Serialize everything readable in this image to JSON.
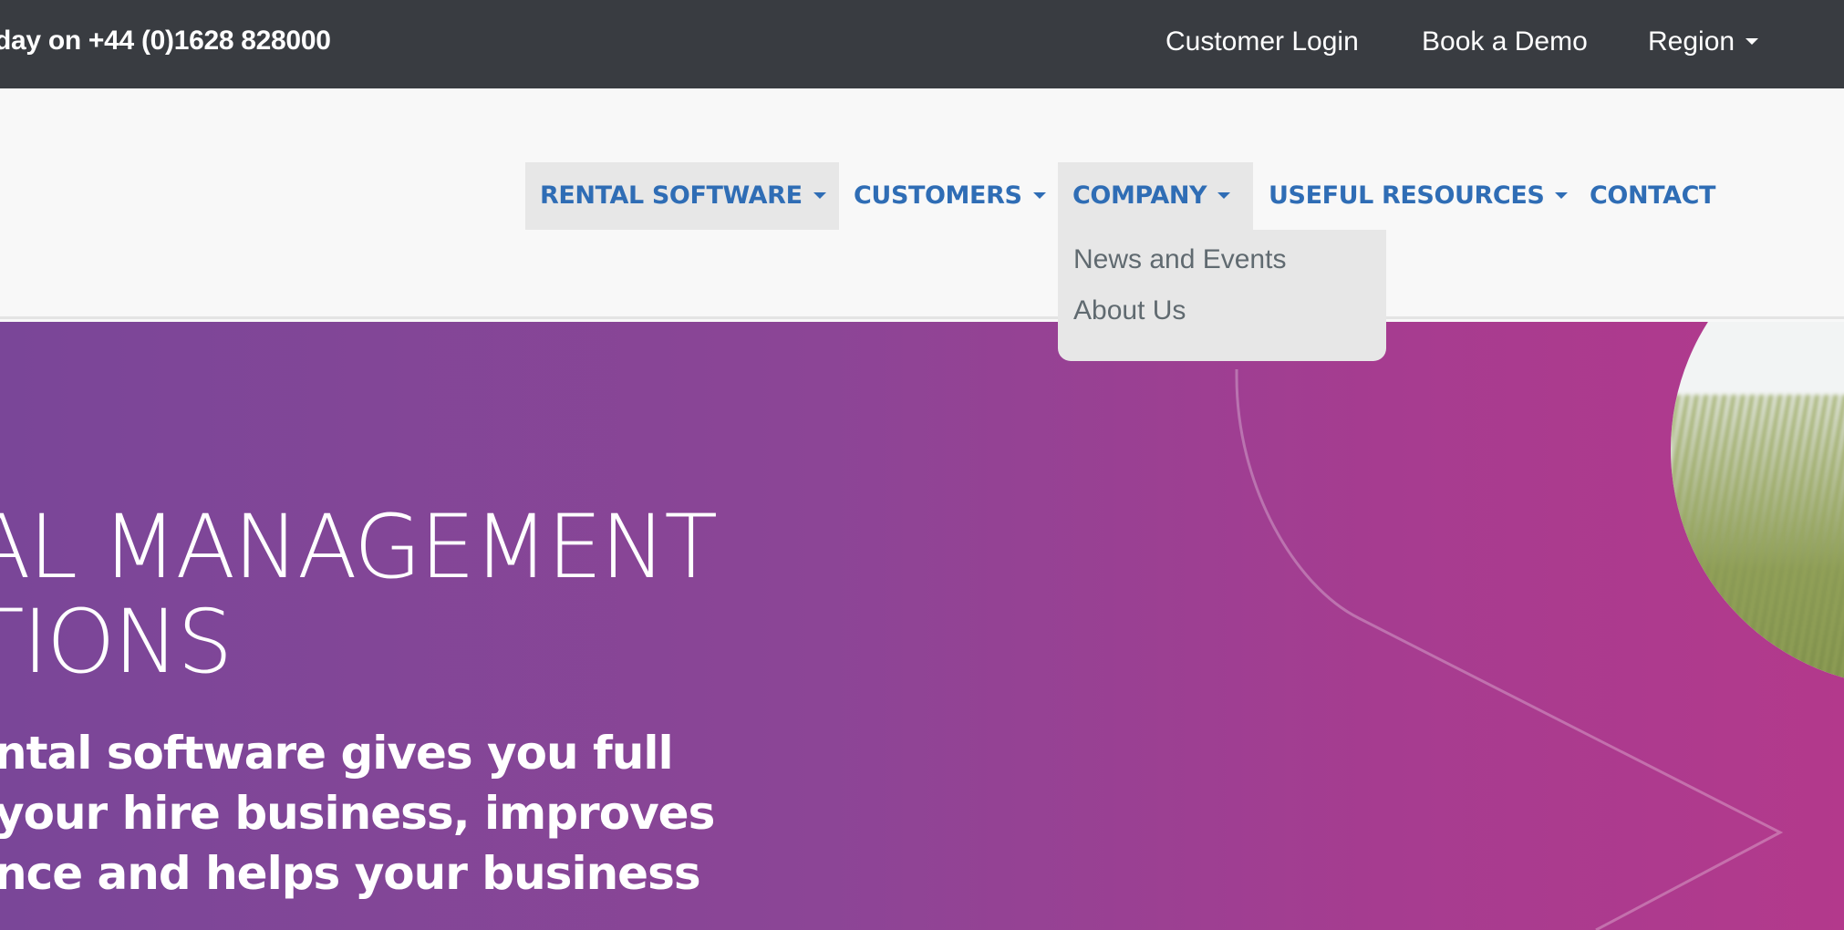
{
  "topbar": {
    "phone_text": "day on +44 (0)1628 828000",
    "links": [
      {
        "label": "Customer Login"
      },
      {
        "label": "Book a Demo"
      },
      {
        "label": "Region",
        "has_dropdown": true
      }
    ],
    "background_color": "#393c41"
  },
  "nav": {
    "items": [
      {
        "label": "RENTAL SOFTWARE",
        "has_dropdown": true,
        "highlighted": true
      },
      {
        "label": "CUSTOMERS",
        "has_dropdown": true,
        "highlighted": false
      },
      {
        "label": "COMPANY",
        "has_dropdown": true,
        "highlighted": true,
        "open": true
      },
      {
        "label": "USEFUL RESOURCES",
        "has_dropdown": true,
        "highlighted": false
      },
      {
        "label": "CONTACT",
        "has_dropdown": false,
        "highlighted": false
      }
    ],
    "link_color": "#2f6db5",
    "company_dropdown": [
      {
        "label": "News and Events"
      },
      {
        "label": "About Us"
      }
    ]
  },
  "hero": {
    "headline_lines": [
      "AL MANAGEMENT",
      "TIONS"
    ],
    "subtext_lines": [
      "ntal software gives you full",
      "your hire business, improves",
      "nce and helps your business"
    ],
    "gradient_start": "#7a4698",
    "gradient_end": "#b3398c",
    "image_semantic": "plant-photo-circle"
  }
}
